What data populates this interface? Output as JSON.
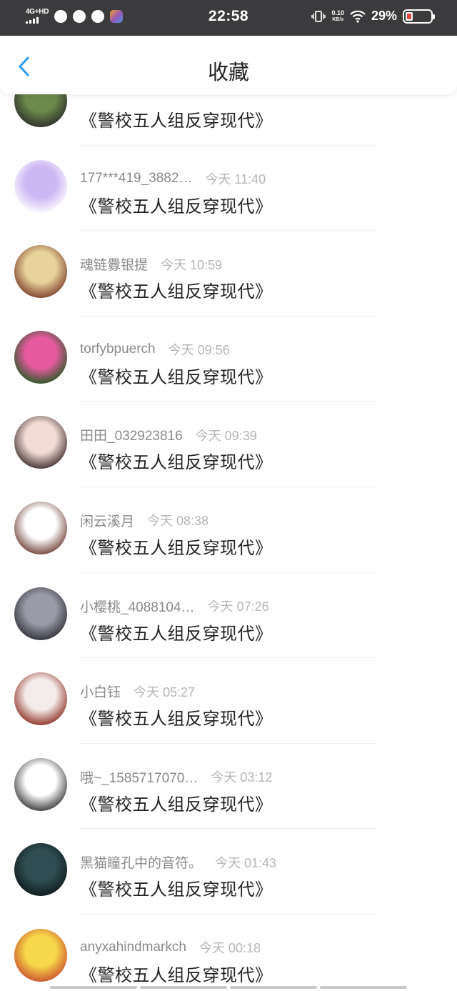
{
  "status_bar": {
    "network": "4G+HD",
    "time": "22:58",
    "speed_value": "0.10",
    "speed_unit": "KB/s",
    "battery": "29%",
    "battery_level": 0.29
  },
  "header": {
    "title": "收藏",
    "back_icon": "chevron-left-icon"
  },
  "items": [
    {
      "name": "",
      "time": "",
      "title": "《警校五人组反穿现代》",
      "avatar_colors": [
        "#6c8a4a",
        "#2b2b2b"
      ]
    },
    {
      "name": "177***419_3882…",
      "time": "今天 11:40",
      "title": "《警校五人组反穿现代》",
      "avatar_colors": [
        "#cdb7f4",
        "#ffffff"
      ]
    },
    {
      "name": "魂链釁银提",
      "time": "今天 10:59",
      "title": "《警校五人组反穿现代》",
      "avatar_colors": [
        "#e8d39a",
        "#7a3a2a"
      ]
    },
    {
      "name": "torfybpuerch",
      "time": "今天 09:56",
      "title": "《警校五人组反穿现代》",
      "avatar_colors": [
        "#e85aa0",
        "#1f5a1f"
      ]
    },
    {
      "name": "田田_032923816",
      "time": "今天 09:39",
      "title": "《警校五人组反穿现代》",
      "avatar_colors": [
        "#f3dcd5",
        "#3a2a2a"
      ]
    },
    {
      "name": "闲云溪月",
      "time": "今天 08:38",
      "title": "《警校五人组反穿现代》",
      "avatar_colors": [
        "#ffffff",
        "#6b3a30"
      ]
    },
    {
      "name": "小樱桃_4088104…",
      "time": "今天 07:26",
      "title": "《警校五人组反穿现代》",
      "avatar_colors": [
        "#9a9aa8",
        "#2d2d36"
      ]
    },
    {
      "name": "小白钰",
      "time": "今天 05:27",
      "title": "《警校五人组反穿现代》",
      "avatar_colors": [
        "#f4ecea",
        "#8a2a1e"
      ]
    },
    {
      "name": "哦~_1585717070…",
      "time": "今天 03:12",
      "title": "《警校五人组反穿现代》",
      "avatar_colors": [
        "#ffffff",
        "#333333"
      ]
    },
    {
      "name": "黑猫瞳孔中的音符。",
      "time": "今天 01:43",
      "title": "《警校五人组反穿现代》",
      "avatar_colors": [
        "#2f4d52",
        "#0e1a1c"
      ]
    },
    {
      "name": "anyxahindmarkch",
      "time": "今天 00:18",
      "title": "《警校五人组反穿现代》",
      "avatar_colors": [
        "#f7d84a",
        "#c94b2c"
      ]
    }
  ]
}
